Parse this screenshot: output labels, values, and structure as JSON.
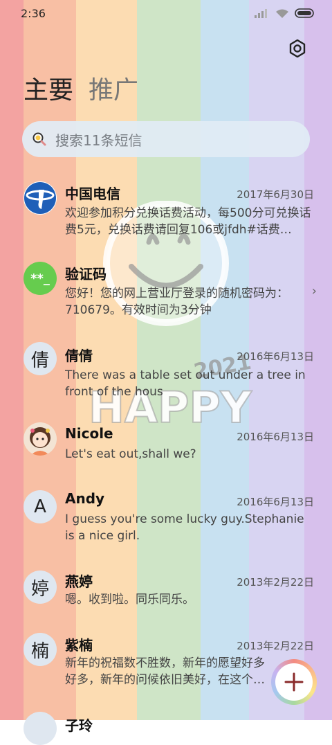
{
  "status_bar": {
    "time": "2:36"
  },
  "background_stripes": [
    "#f4a0a0",
    "#f9c2a6",
    "#fbe0b0",
    "#cfe6c8",
    "#c6e0f2",
    "#d9d5f3",
    "#d8c1ee"
  ],
  "tabs": {
    "primary": "主要",
    "promotions": "推广"
  },
  "search": {
    "placeholder": "搜索11条短信"
  },
  "watermark": {
    "year": "2021",
    "word": "HAPPY"
  },
  "conversations": [
    {
      "avatar_text": "",
      "avatar_type": "logo",
      "name": "中国电信",
      "date": "2017年6月30日",
      "preview": "欢迎参加积分兑换话费活动，每500分可兑换话费5元，兑换话费请回复106或jfdh#话费…"
    },
    {
      "avatar_text": "**_",
      "avatar_type": "code",
      "name": "验证码",
      "date": "",
      "preview": "您好！您的网上营业厅登录的随机密码为：710679。有效时间为3分钟"
    },
    {
      "avatar_text": "倩",
      "avatar_type": "letter",
      "name": "倩倩",
      "date": "2016年6月13日",
      "preview": "There was a table set out under a tree in front of the hous"
    },
    {
      "avatar_text": "",
      "avatar_type": "photo",
      "name": "Nicole",
      "date": "2016年6月13日",
      "preview": "Let's eat out,shall we?"
    },
    {
      "avatar_text": "A",
      "avatar_type": "letter",
      "name": "Andy",
      "date": "2016年6月13日",
      "preview": "I guess you're some lucky guy.Stephanie is a nice girl."
    },
    {
      "avatar_text": "婷",
      "avatar_type": "letter",
      "name": "燕婷",
      "date": "2013年2月22日",
      "preview": "嗯。收到啦。同乐同乐。"
    },
    {
      "avatar_text": "楠",
      "avatar_type": "letter",
      "name": "紫楠",
      "date": "2013年2月22日",
      "preview": "新年的祝福数不胜数，新年的愿望好多好多，新年的问候依旧美好，在这个温馨的时刻…"
    },
    {
      "avatar_text": "",
      "avatar_type": "letter",
      "name": "子玲",
      "date": "",
      "preview": ""
    }
  ],
  "fab": {
    "icon": "plus-icon"
  }
}
